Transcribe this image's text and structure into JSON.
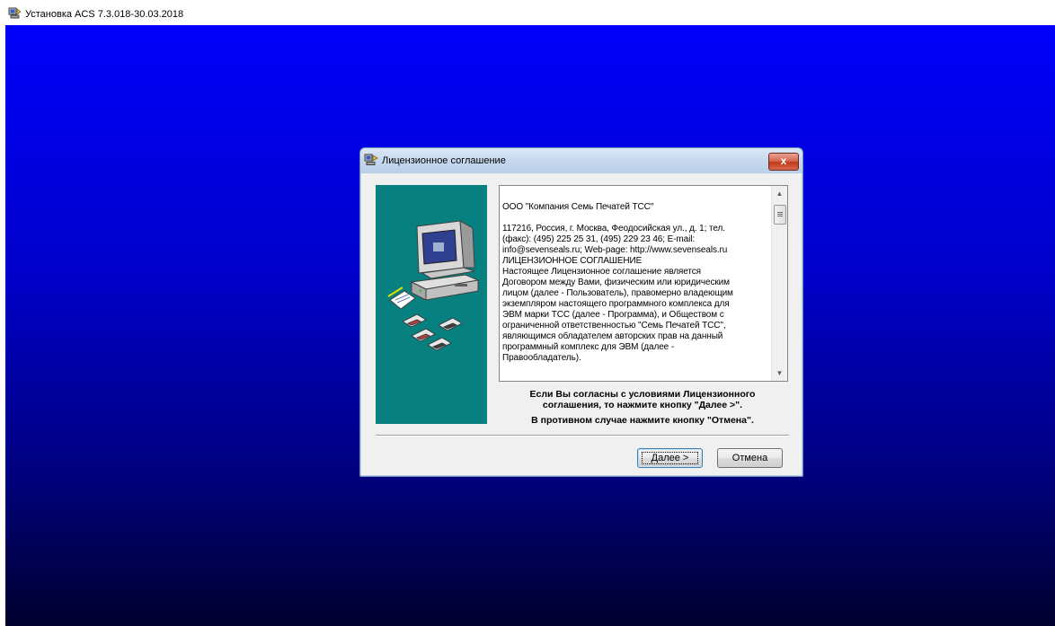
{
  "window": {
    "title": "Установка ACS 7.3.018-30.03.2018",
    "icon": "installer-icon"
  },
  "dialog": {
    "title": "Лицензионное соглашение",
    "icon": "installer-icon",
    "close_label": "x",
    "side_image": "computer-with-disks-illustration",
    "license_text": "ООО \"Компания Семь Печатей ТСС\"\n\n117216, Россия, г. Москва, Феодосийская ул., д. 1; тел.\n(факс): (495) 225 25 31, (495) 229 23 46; E-mail:\ninfo@sevenseals.ru; Web-page: http://www.sevenseals.ru\nЛИЦЕНЗИОННОЕ СОГЛАШЕНИЕ\nНастоящее Лицензионное соглашение является\nДоговором между Вами, физическим или юридическим\nлицом (далее - Пользователь), правомерно владеющим\nэкземпляром настоящего программного комплекса для\nЭВМ марки ТСС (далее - Программа), и Обществом с\nограниченной ответственностью \"Семь Печатей ТСС\",\nявляющимся обладателем авторских прав на данный\nпрограммный комплекс для ЭВМ (далее -\nПравообладатель).",
    "note_line1": "Если Вы согласны с условиями Лицензионного",
    "note_line2": "соглашения, то нажмите кнопку \"Далее >\".",
    "note_line3": "В противном случае нажмите кнопку \"Отмена\".",
    "next_label": "Далее >",
    "cancel_label": "Отмена"
  },
  "colors": {
    "desktop_top": "#0000ff",
    "desktop_bottom": "#00002e",
    "side_image_bg": "#088080"
  }
}
